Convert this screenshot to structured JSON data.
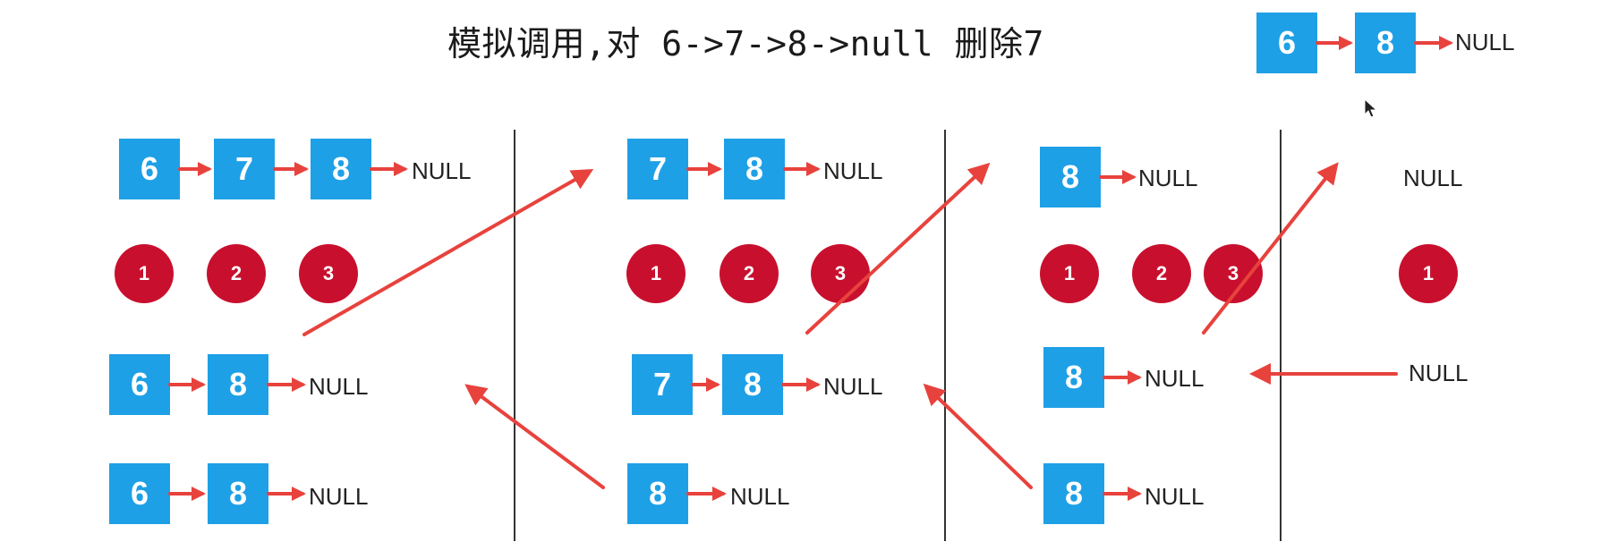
{
  "title": "模拟调用,对 6->7->8->null 删除7",
  "null_label": "NULL",
  "colors": {
    "node": "#1ea0e6",
    "arrow": "#e8423d",
    "circle": "#c8102e",
    "divider": "#333333"
  },
  "result": [
    "6",
    "8"
  ],
  "columns": [
    {
      "input": [
        "6",
        "7",
        "8"
      ],
      "circles": [
        "1",
        "2",
        "3"
      ],
      "returned": [
        "6",
        "8"
      ],
      "sub_result": [
        "6",
        "8"
      ]
    },
    {
      "input": [
        "7",
        "8"
      ],
      "circles": [
        "1",
        "2",
        "3"
      ],
      "returned": [
        "7",
        "8"
      ],
      "sub_result": [
        "8"
      ]
    },
    {
      "input": [
        "8"
      ],
      "circles": [
        "1",
        "2",
        "3"
      ],
      "returned": [
        "8"
      ],
      "sub_result": [
        "8"
      ]
    },
    {
      "input": [],
      "circles": [
        "1"
      ],
      "returned": []
    }
  ]
}
